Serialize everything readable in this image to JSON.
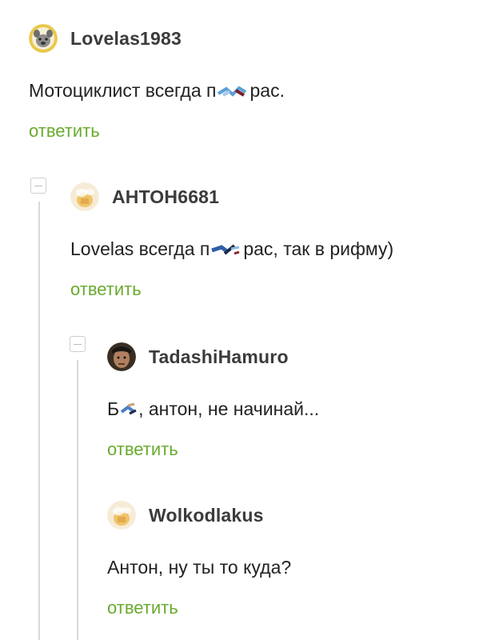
{
  "comments": [
    {
      "username": "Lovelas1983",
      "avatar_icon": "bulldog-avatar-icon",
      "text_before": "Мотоциклист всегда п",
      "text_after": "рас.",
      "reply_label": "ответить"
    },
    {
      "username": "АНТОН6681",
      "avatar_icon": "stock-blurred-avatar-icon",
      "text_before": "Lovelas всегда п",
      "text_after": "рас, так в рифму)",
      "reply_label": "ответить"
    },
    {
      "username": "TadashiHamuro",
      "avatar_icon": "photo-avatar-icon",
      "text_before": "Б",
      "text_after": ", антон, не начинай...",
      "reply_label": "ответить"
    },
    {
      "username": "Wolkodlakus",
      "avatar_icon": "stock-blurred-avatar-icon",
      "text": "Антон, ну ты то куда?",
      "reply_label": "ответить"
    }
  ],
  "colors": {
    "reply_link": "#6aaa2e",
    "thread_line": "#d9d9d9",
    "username": "#3b3b3b"
  }
}
